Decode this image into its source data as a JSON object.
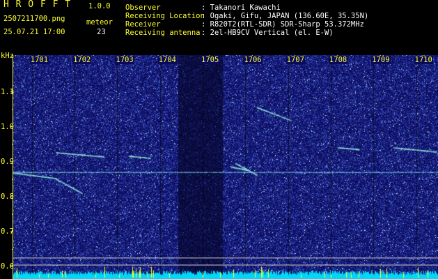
{
  "app": {
    "name": "H R O F F T",
    "version": "1.0.0"
  },
  "file": {
    "name": "2507211700.png",
    "datetime": "25.07.21 17:00"
  },
  "meteor": {
    "label": "meteor",
    "count": "23"
  },
  "info": [
    {
      "label": "Observer",
      "value": ": Takanori Kawachi"
    },
    {
      "label": "Receiving Location",
      "value": ": Ogaki, Gifu, JAPAN (136.60E, 35.35N)"
    },
    {
      "label": "Receiver",
      "value": ": R820T2(RTL-SDR) SDR-Sharp 53.372MHz"
    },
    {
      "label": "Receiving antenna",
      "value": ": 2el-HB9CV Vertical (el. E-W)"
    }
  ],
  "colors": {
    "header_yellow": "#ffff30",
    "background": "#000000",
    "spectrogram_base": "#0a0a5a",
    "noise_floor_cyan": "#00e0ff"
  },
  "chart_data": {
    "type": "heatmap",
    "ylabel": "kHz",
    "y_ticks": [
      "1.1",
      "1.0",
      "0.9",
      "0.8",
      "0.7",
      "0.6"
    ],
    "y_values": [
      1.1,
      1.0,
      0.9,
      0.8,
      0.7,
      0.6
    ],
    "ylim": [
      0.565,
      1.205
    ],
    "x_ticks": [
      "1701",
      "1702",
      "1703",
      "1704",
      "1705",
      "1706",
      "1707",
      "1708",
      "1709",
      "1710"
    ],
    "x_values": [
      1701,
      1702,
      1703,
      1704,
      1705,
      1706,
      1707,
      1708,
      1709,
      1710
    ],
    "xlim": [
      1700.4,
      1710.35
    ],
    "carrier_khz": 0.87,
    "gap_minutes": [
      1704.25,
      1705.3
    ],
    "meteor_echoes": [
      {
        "t": [
          1700.4,
          1701.4
        ],
        "f": [
          0.868,
          0.852
        ]
      },
      {
        "t": [
          1701.4,
          1702.0
        ],
        "f": [
          0.85,
          0.81
        ]
      },
      {
        "t": [
          1705.6,
          1706.1
        ],
        "f": [
          0.895,
          0.862
        ]
      },
      {
        "t": [
          1705.5,
          1705.9
        ],
        "f": [
          0.885,
          0.875
        ]
      },
      {
        "t": [
          1709.3,
          1710.3
        ],
        "f": [
          0.94,
          0.928
        ]
      },
      {
        "t": [
          1706.1,
          1706.9
        ],
        "f": [
          1.055,
          1.018
        ]
      },
      {
        "t": [
          1701.4,
          1702.5
        ],
        "f": [
          0.926,
          0.914
        ]
      },
      {
        "t": [
          1703.1,
          1703.6
        ],
        "f": [
          0.916,
          0.91
        ]
      },
      {
        "t": [
          1708.0,
          1708.5
        ],
        "f": [
          0.94,
          0.935
        ]
      }
    ]
  }
}
